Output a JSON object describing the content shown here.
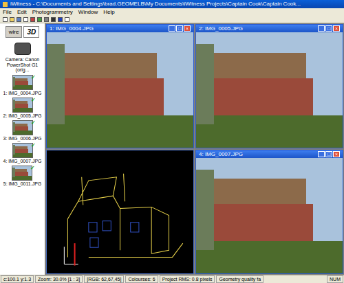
{
  "window": {
    "title": "iWitness - C:\\Documents and Settings\\brad.GEOMELB\\My Documents\\iWitness Projects\\Captain Cook\\Captain Cook..."
  },
  "menu": [
    "File",
    "Edit",
    "Photogrammetry",
    "Window",
    "Help"
  ],
  "view_buttons": [
    {
      "label": "wire",
      "selected": false
    },
    {
      "label": "3D",
      "selected": true
    }
  ],
  "camera": {
    "label": "Camera: Canon PowerShot G1 (orig..."
  },
  "thumbnails": [
    {
      "label": "1: IMG_0004.JPG",
      "checked": true
    },
    {
      "label": "2: IMG_0005.JPG",
      "checked": true
    },
    {
      "label": "3: IMG_0006.JPG",
      "checked": true
    },
    {
      "label": "4: IMG_0007.JPG",
      "checked": true
    },
    {
      "label": "5: IMG_0011.JPG",
      "checked": true
    }
  ],
  "child_window_buttons": [
    "_",
    "□",
    "×"
  ],
  "child_windows": [
    {
      "title": "1: IMG_0004.JPG",
      "kind": "photo"
    },
    {
      "title": "2: IMG_0005.JPG",
      "kind": "photo"
    },
    {
      "title": "",
      "kind": "3d"
    },
    {
      "title": "4: IMG_0007.JPG",
      "kind": "photo"
    }
  ],
  "status_bar": [
    "c:100.1 y:1.3",
    "Zoom: 30.0% [1 : 3]",
    "[RGB: 62,67,45]",
    "Colourses: 6",
    "Project RMS: 0.8 pixels",
    "Geometry quality fa",
    "NUM"
  ]
}
